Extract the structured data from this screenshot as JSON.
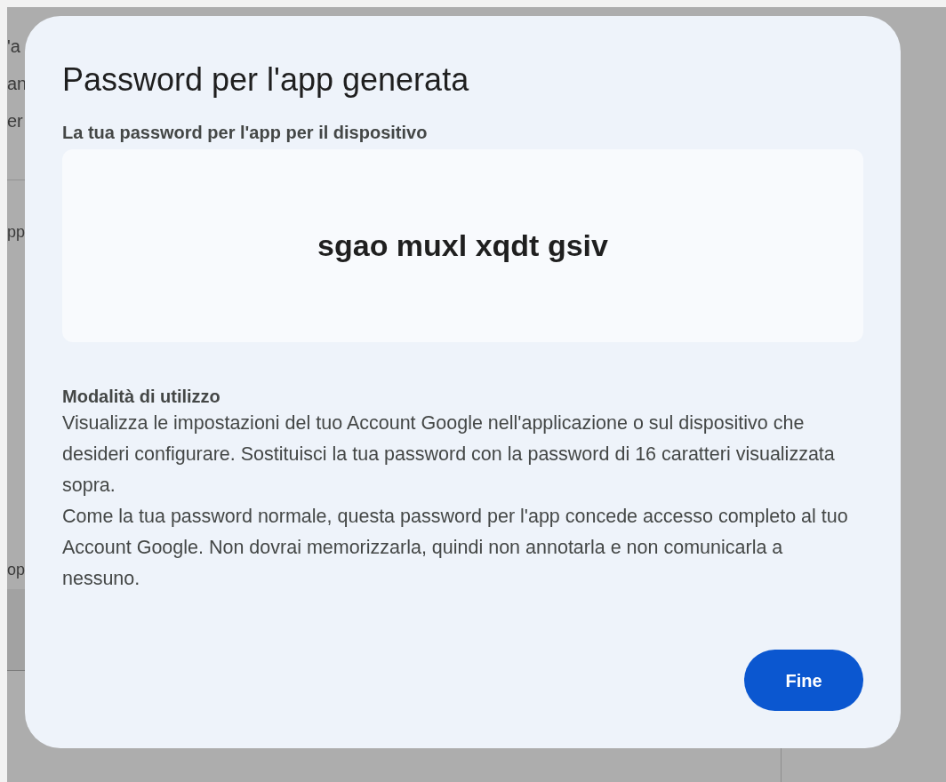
{
  "background": {
    "fragments": [
      "'a",
      "an",
      "er",
      "pp",
      "op"
    ]
  },
  "dialog": {
    "title": "Password per l'app generata",
    "password_label": "La tua password per l'app per il dispositivo",
    "password": "sgao muxl xqdt gsiv",
    "usage_heading": "Modalità di utilizzo",
    "usage_paragraphs": [
      "Visualizza le impostazioni del tuo Account Google nell'applicazione o sul dispositivo che desideri configurare. Sostituisci la tua password con la password di 16 caratteri visualizzata sopra.",
      "Come la tua password normale, questa password per l'app concede accesso completo al tuo Account Google. Non dovrai memorizzarla, quindi non annotarla e non comunicarla a nessuno."
    ],
    "done_button": "Fine"
  }
}
